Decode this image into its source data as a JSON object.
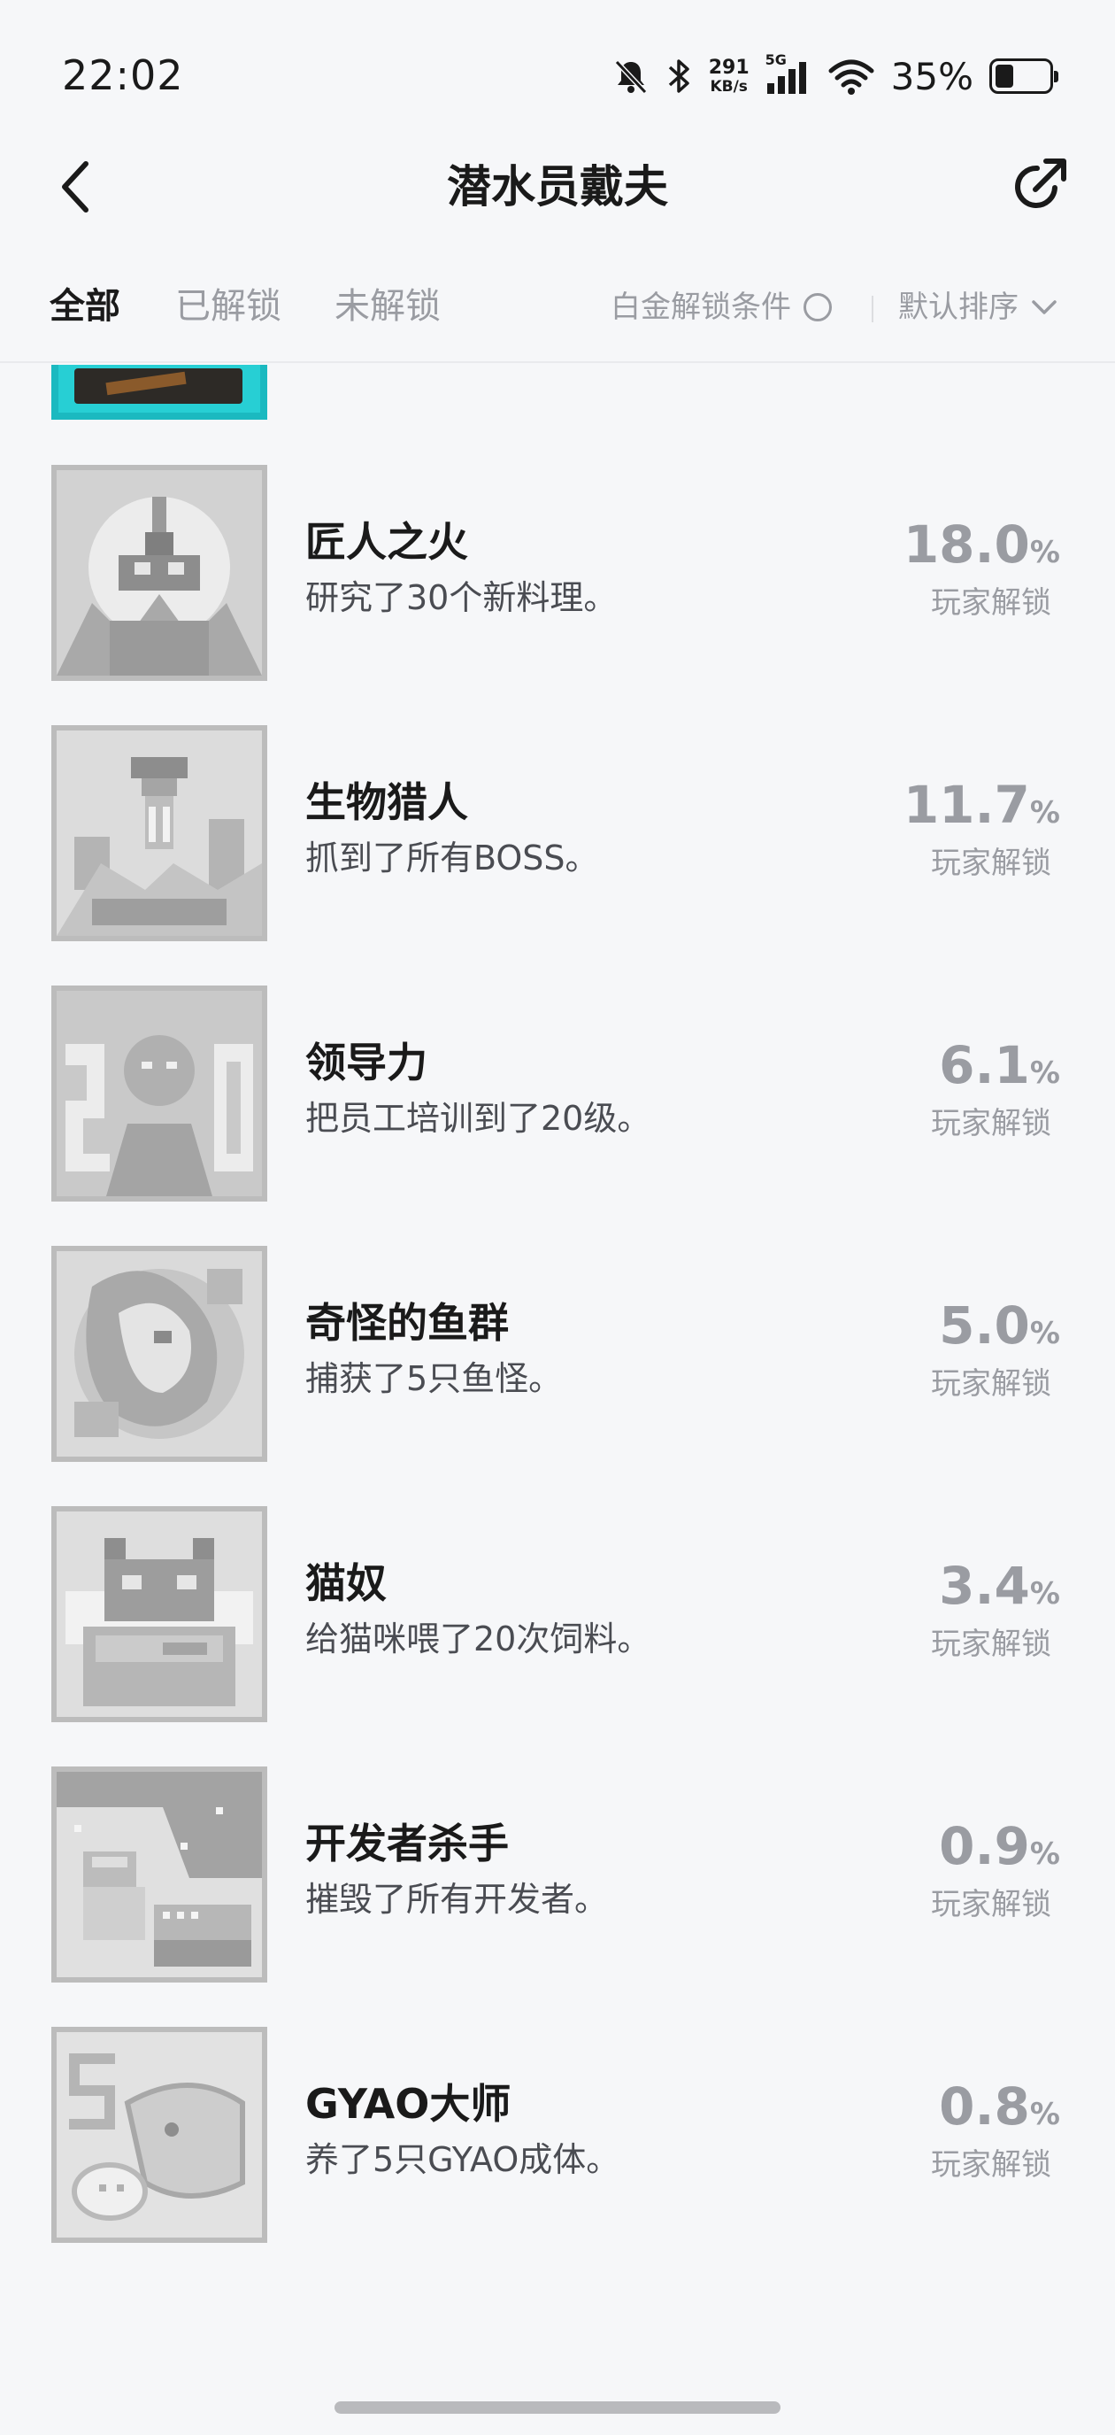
{
  "status_bar": {
    "time": "22:02",
    "net_speed_value": "291",
    "net_speed_unit": "KB/s",
    "network_tag": "5G",
    "battery_percent": "35%",
    "battery_level": 0.35,
    "icons": [
      "mute-bell-icon",
      "bluetooth-icon",
      "signal-icon",
      "wifi-icon",
      "battery-icon"
    ]
  },
  "header": {
    "title": "潜水员戴夫",
    "back_icon": "chevron-left-icon",
    "share_icon": "share-icon"
  },
  "tabs": [
    {
      "label": "全部",
      "active": true
    },
    {
      "label": "已解锁",
      "active": false
    },
    {
      "label": "未解锁",
      "active": false
    }
  ],
  "filter": {
    "label": "白金解锁条件",
    "checked": false
  },
  "sort": {
    "label": "默认排序",
    "icon": "chevron-down-icon"
  },
  "achievements": [
    {
      "title": "匠人之火",
      "desc": "研究了30个新料理。",
      "percent": "18.0",
      "unit": "%",
      "label": "玩家解锁",
      "icon": "flame-achievement-icon"
    },
    {
      "title": "生物猎人",
      "desc": "抓到了所有BOSS。",
      "percent": "11.7",
      "unit": "%",
      "label": "玩家解锁",
      "icon": "hunter-achievement-icon"
    },
    {
      "title": "领导力",
      "desc": "把员工培训到了20级。",
      "percent": "6.1",
      "unit": "%",
      "label": "玩家解锁",
      "icon": "leadership-achievement-icon"
    },
    {
      "title": "奇怪的鱼群",
      "desc": "捕获了5只鱼怪。",
      "percent": "5.0",
      "unit": "%",
      "label": "玩家解锁",
      "icon": "fish-achievement-icon"
    },
    {
      "title": "猫奴",
      "desc": "给猫咪喂了20次饲料。",
      "percent": "3.4",
      "unit": "%",
      "label": "玩家解锁",
      "icon": "cat-achievement-icon"
    },
    {
      "title": "开发者杀手",
      "desc": "摧毁了所有开发者。",
      "percent": "0.9",
      "unit": "%",
      "label": "玩家解锁",
      "icon": "developer-achievement-icon"
    },
    {
      "title": "GYAO大师",
      "desc": "养了5只GYAO成体。",
      "percent": "0.8",
      "unit": "%",
      "label": "玩家解锁",
      "icon": "gyao-achievement-icon"
    }
  ]
}
